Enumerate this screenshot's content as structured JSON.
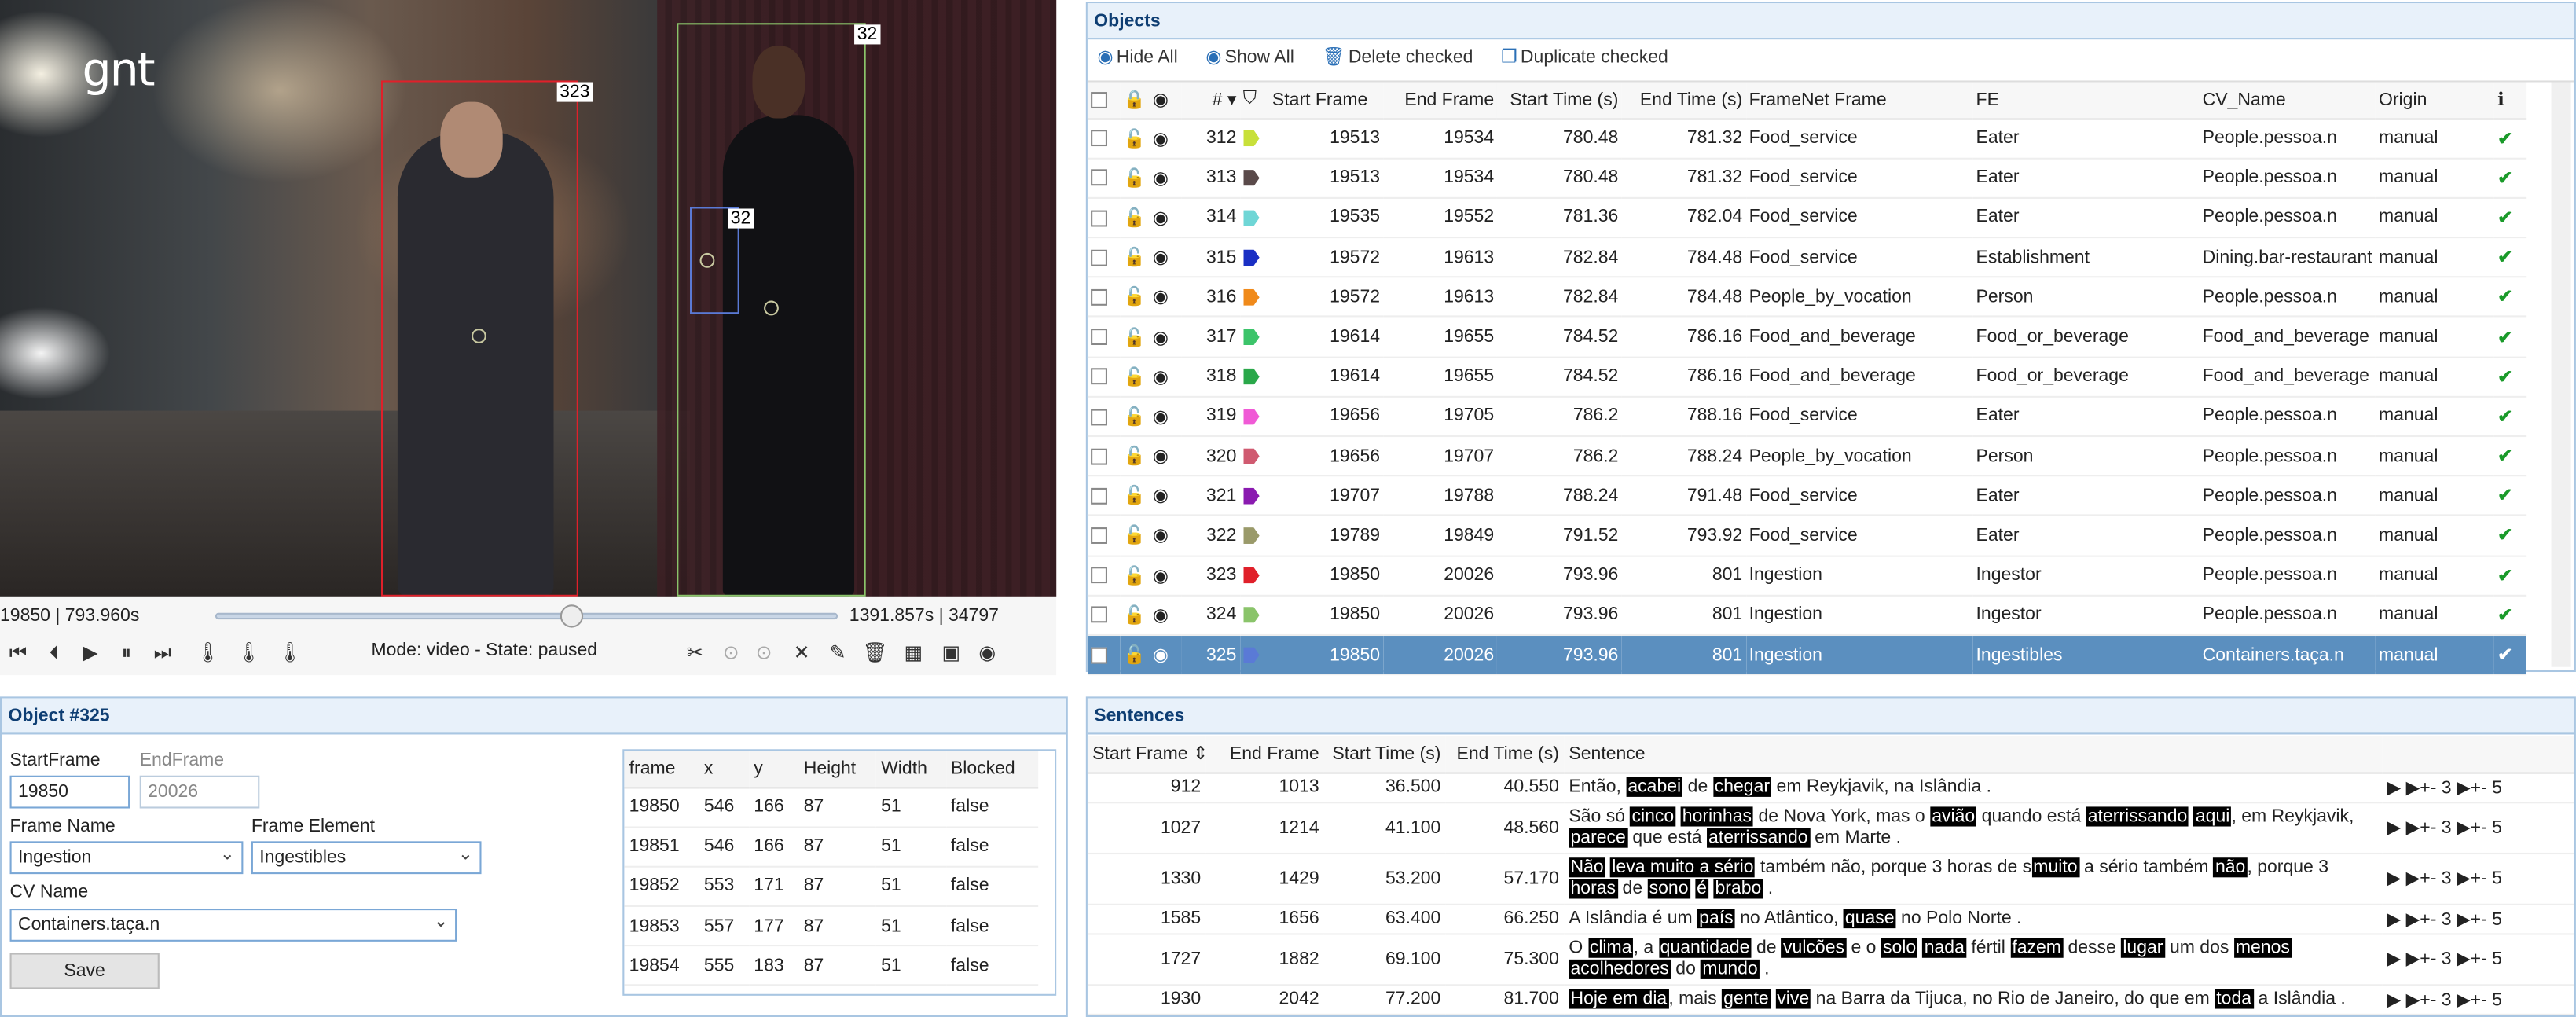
{
  "video": {
    "logo": "gnt",
    "box_labels": [
      "323",
      "32",
      "32"
    ],
    "frame_time": "19850 | 793.960s",
    "duration": "1391.857s | 34797",
    "position": 0.5703,
    "mode": "Mode: video - State: paused"
  },
  "objects": {
    "title": "Objects",
    "toolbar": {
      "hide_all": "Hide All",
      "show_all": "Show All",
      "delete_checked": "Delete checked",
      "duplicate_checked": "Duplicate checked"
    },
    "headers": [
      "#",
      "Start Frame",
      "End Frame",
      "Start Time (s)",
      "End Time (s)",
      "FrameNet Frame",
      "FE",
      "CV_Name",
      "Origin"
    ],
    "rows": [
      {
        "id": "312",
        "color": "#c8e03a",
        "start": "19513",
        "end": "19534",
        "st": "780.48",
        "et": "781.32",
        "frame": "Food_service",
        "fe": "Eater",
        "cv": "People.pessoa.n",
        "origin": "manual"
      },
      {
        "id": "313",
        "color": "#5a4a4a",
        "start": "19513",
        "end": "19534",
        "st": "780.48",
        "et": "781.32",
        "frame": "Food_service",
        "fe": "Eater",
        "cv": "People.pessoa.n",
        "origin": "manual"
      },
      {
        "id": "314",
        "color": "#6fd6d6",
        "start": "19535",
        "end": "19552",
        "st": "781.36",
        "et": "782.04",
        "frame": "Food_service",
        "fe": "Eater",
        "cv": "People.pessoa.n",
        "origin": "manual"
      },
      {
        "id": "315",
        "color": "#1a2fc4",
        "start": "19572",
        "end": "19613",
        "st": "782.84",
        "et": "784.48",
        "frame": "Food_service",
        "fe": "Establishment",
        "cv": "Dining.bar-restaurant",
        "origin": "manual"
      },
      {
        "id": "316",
        "color": "#f08a1a",
        "start": "19572",
        "end": "19613",
        "st": "782.84",
        "et": "784.48",
        "frame": "People_by_vocation",
        "fe": "Person",
        "cv": "People.pessoa.n",
        "origin": "manual"
      },
      {
        "id": "317",
        "color": "#3cc46a",
        "start": "19614",
        "end": "19655",
        "st": "784.52",
        "et": "786.16",
        "frame": "Food_and_beverage",
        "fe": "Food_or_beverage",
        "cv": "Food_and_beverage",
        "origin": "manual"
      },
      {
        "id": "318",
        "color": "#2aa84a",
        "start": "19614",
        "end": "19655",
        "st": "784.52",
        "et": "786.16",
        "frame": "Food_and_beverage",
        "fe": "Food_or_beverage",
        "cv": "Food_and_beverage",
        "origin": "manual"
      },
      {
        "id": "319",
        "color": "#f05ad6",
        "start": "19656",
        "end": "19705",
        "st": "786.2",
        "et": "788.16",
        "frame": "Food_service",
        "fe": "Eater",
        "cv": "People.pessoa.n",
        "origin": "manual"
      },
      {
        "id": "320",
        "color": "#d05a70",
        "start": "19656",
        "end": "19707",
        "st": "786.2",
        "et": "788.24",
        "frame": "People_by_vocation",
        "fe": "Person",
        "cv": "People.pessoa.n",
        "origin": "manual"
      },
      {
        "id": "321",
        "color": "#8a1ab0",
        "start": "19707",
        "end": "19788",
        "st": "788.24",
        "et": "791.48",
        "frame": "Food_service",
        "fe": "Eater",
        "cv": "People.pessoa.n",
        "origin": "manual"
      },
      {
        "id": "322",
        "color": "#9a9a6a",
        "start": "19789",
        "end": "19849",
        "st": "791.52",
        "et": "793.92",
        "frame": "Food_service",
        "fe": "Eater",
        "cv": "People.pessoa.n",
        "origin": "manual"
      },
      {
        "id": "323",
        "color": "#e0202a",
        "start": "19850",
        "end": "20026",
        "st": "793.96",
        "et": "801",
        "frame": "Ingestion",
        "fe": "Ingestor",
        "cv": "People.pessoa.n",
        "origin": "manual"
      },
      {
        "id": "324",
        "color": "#8ac46a",
        "start": "19850",
        "end": "20026",
        "st": "793.96",
        "et": "801",
        "frame": "Ingestion",
        "fe": "Ingestor",
        "cv": "People.pessoa.n",
        "origin": "manual"
      },
      {
        "id": "325",
        "color": "#5a7ad6",
        "start": "19850",
        "end": "20026",
        "st": "793.96",
        "et": "801",
        "frame": "Ingestion",
        "fe": "Ingestibles",
        "cv": "Containers.taça.n",
        "origin": "manual",
        "selected": true
      }
    ]
  },
  "detail": {
    "title": "Object #325",
    "start_label": "StartFrame",
    "start_value": "19850",
    "end_label": "EndFrame",
    "end_value": "20026",
    "frame_name_label": "Frame Name",
    "frame_name_value": "Ingestion",
    "frame_element_label": "Frame Element",
    "frame_element_value": "Ingestibles",
    "cv_label": "CV Name",
    "cv_value": "Containers.taça.n",
    "save_label": "Save",
    "frame_headers": [
      "frame",
      "x",
      "y",
      "Height",
      "Width",
      "Blocked"
    ],
    "frames": [
      [
        "19850",
        "546",
        "166",
        "87",
        "51",
        "false"
      ],
      [
        "19851",
        "546",
        "166",
        "87",
        "51",
        "false"
      ],
      [
        "19852",
        "553",
        "171",
        "87",
        "51",
        "false"
      ],
      [
        "19853",
        "557",
        "177",
        "87",
        "51",
        "false"
      ],
      [
        "19854",
        "555",
        "183",
        "87",
        "51",
        "false"
      ]
    ]
  },
  "sentences": {
    "title": "Sentences",
    "headers": [
      "Start Frame",
      "End Frame",
      "Start Time (s)",
      "End Time (s)",
      "Sentence"
    ],
    "play_labels": [
      "+- 3",
      "+- 5"
    ],
    "rows": [
      {
        "sf": "912",
        "ef": "1013",
        "st": "36.500",
        "et": "40.550",
        "tokens": [
          [
            "Então, ",
            0
          ],
          [
            "acabei",
            1
          ],
          [
            " de ",
            0
          ],
          [
            "chegar",
            1
          ],
          [
            " em Reykjavik, na Islândia .",
            0
          ]
        ]
      },
      {
        "sf": "1027",
        "ef": "1214",
        "st": "41.100",
        "et": "48.560",
        "tokens": [
          [
            "São só ",
            0
          ],
          [
            "cinco",
            1
          ],
          [
            " ",
            0
          ],
          [
            "horinhas",
            1
          ],
          [
            " de Nova York, mas o ",
            0
          ],
          [
            "avião",
            1
          ],
          [
            " quando está ",
            0
          ],
          [
            "aterrissando",
            1
          ],
          [
            " ",
            0
          ],
          [
            "aqui",
            1
          ],
          [
            ", em Reykjavik, ",
            0
          ],
          [
            "parece",
            1
          ],
          [
            " que está ",
            0
          ],
          [
            "aterrissando",
            1
          ],
          [
            " em Marte .",
            0
          ]
        ]
      },
      {
        "sf": "1330",
        "ef": "1429",
        "st": "53.200",
        "et": "57.170",
        "tokens": [
          [
            "Não",
            1
          ],
          [
            " ",
            0
          ],
          [
            "leva muito a sério",
            1
          ],
          [
            " também não, porque 3 horas de s",
            0
          ],
          [
            "muito",
            1
          ],
          [
            " a sério também ",
            0
          ],
          [
            "não",
            1
          ],
          [
            ", porque 3 ",
            0
          ],
          [
            "horas",
            1
          ],
          [
            " de ",
            0
          ],
          [
            "sono",
            1
          ],
          [
            " ",
            0
          ],
          [
            "é",
            1
          ],
          [
            " ",
            0
          ],
          [
            "brabo",
            1
          ],
          [
            " .",
            0
          ]
        ]
      },
      {
        "sf": "1585",
        "ef": "1656",
        "st": "63.400",
        "et": "66.250",
        "tokens": [
          [
            "A Islândia é um ",
            0
          ],
          [
            "país",
            1
          ],
          [
            " no Atlântico, ",
            0
          ],
          [
            "quase",
            1
          ],
          [
            " no Polo Norte .",
            0
          ]
        ]
      },
      {
        "sf": "1727",
        "ef": "1882",
        "st": "69.100",
        "et": "75.300",
        "tokens": [
          [
            "O ",
            0
          ],
          [
            "clima",
            1
          ],
          [
            ", a ",
            0
          ],
          [
            "quantidade",
            1
          ],
          [
            " de ",
            0
          ],
          [
            "vulcões",
            1
          ],
          [
            " e o ",
            0
          ],
          [
            "solo",
            1
          ],
          [
            " ",
            0
          ],
          [
            "nada",
            1
          ],
          [
            " fértil ",
            0
          ],
          [
            "fazem",
            1
          ],
          [
            " desse ",
            0
          ],
          [
            "lugar",
            1
          ],
          [
            " um dos ",
            0
          ],
          [
            "menos",
            1
          ],
          [
            " ",
            0
          ],
          [
            "acolhedores",
            1
          ],
          [
            " do ",
            0
          ],
          [
            "mundo",
            1
          ],
          [
            " .",
            0
          ]
        ]
      },
      {
        "sf": "1930",
        "ef": "2042",
        "st": "77.200",
        "et": "81.700",
        "tokens": [
          [
            "Hoje em dia",
            1
          ],
          [
            ", mais ",
            0
          ],
          [
            "gente",
            1
          ],
          [
            " ",
            0
          ],
          [
            "vive",
            1
          ],
          [
            " na Barra da Tijuca, no Rio de Janeiro, do que em ",
            0
          ],
          [
            "toda",
            1
          ],
          [
            " a Islândia .",
            0
          ]
        ]
      }
    ]
  },
  "colors": {
    "accent": "#0e3e73",
    "selected_row": "#5b8fbf",
    "panel_border": "#a9c6e2",
    "ok": "#1a9a2a"
  }
}
